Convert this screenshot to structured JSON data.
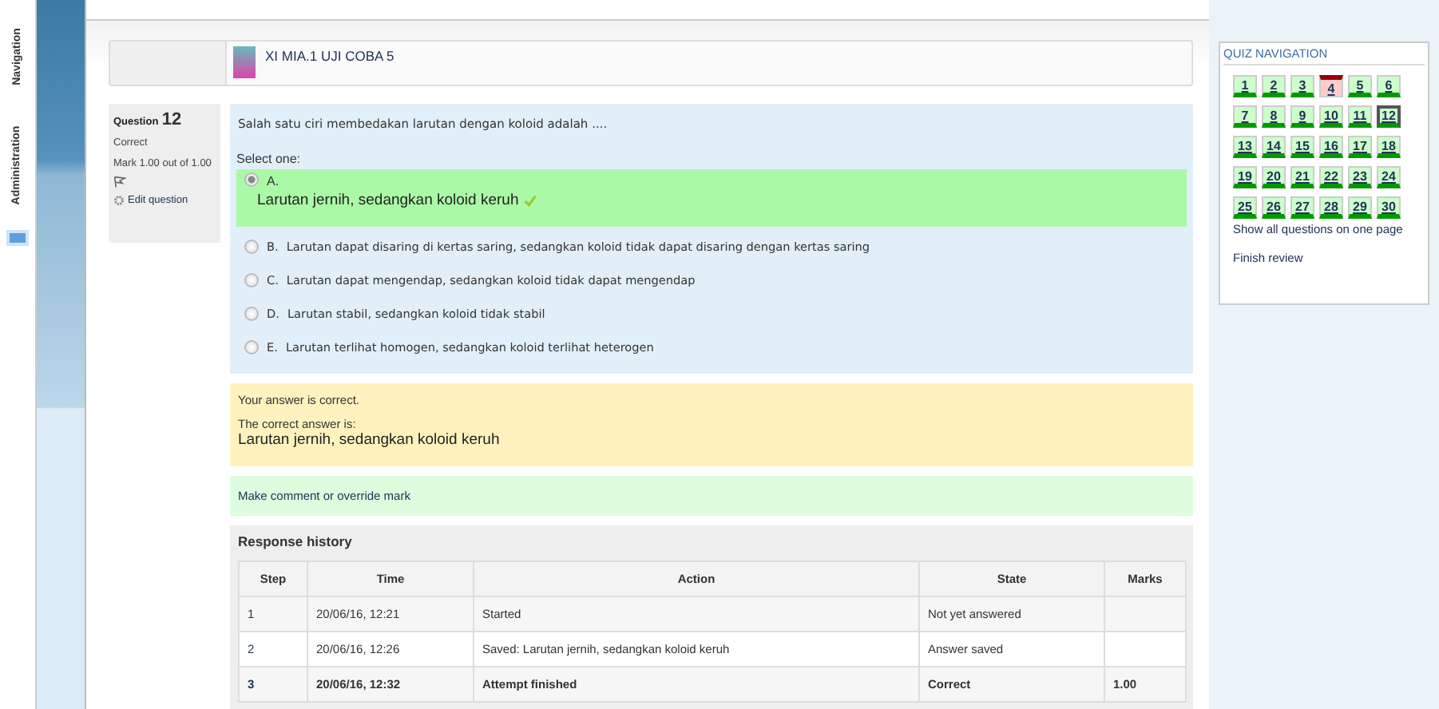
{
  "side_tabs": [
    "Navigation",
    "Administration"
  ],
  "header": {
    "title": "XI MIA.1 UJI COBA 5"
  },
  "info": {
    "label": "Question",
    "number": "12",
    "status": "Correct",
    "mark": "Mark 1.00 out of 1.00",
    "edit": "Edit question"
  },
  "question": {
    "text": "Salah satu ciri membedakan larutan dengan koloid adalah ....",
    "prompt": "Select one:",
    "options": [
      {
        "letter": "A.",
        "text": "Larutan jernih, sedangkan koloid keruh",
        "selected": true,
        "correct": true
      },
      {
        "letter": "B.",
        "text": "Larutan dapat disaring di kertas saring, sedangkan koloid tidak dapat disaring dengan kertas saring",
        "selected": false,
        "correct": false
      },
      {
        "letter": "C.",
        "text": "Larutan dapat mengendap, sedangkan koloid tidak dapat mengendap",
        "selected": false,
        "correct": false
      },
      {
        "letter": "D.",
        "text": "Larutan stabil, sedangkan koloid tidak stabil",
        "selected": false,
        "correct": false
      },
      {
        "letter": "E.",
        "text": "Larutan terlihat homogen, sedangkan koloid terlihat heterogen",
        "selected": false,
        "correct": false
      }
    ]
  },
  "feedback": {
    "result": "Your answer is correct.",
    "correct_label": "The correct answer is:",
    "correct_answer": "Larutan jernih, sedangkan koloid keruh"
  },
  "comment_link": "Make comment or override mark",
  "history": {
    "title": "Response history",
    "columns": [
      "Step",
      "Time",
      "Action",
      "State",
      "Marks"
    ],
    "rows": [
      {
        "bold": false,
        "cells": [
          "1",
          "20/06/16, 12:21",
          "Started",
          "Not yet answered",
          ""
        ]
      },
      {
        "bold": false,
        "cells": [
          "2",
          "20/06/16, 12:26",
          "Saved: Larutan jernih, sedangkan koloid keruh",
          "Answer saved",
          ""
        ]
      },
      {
        "bold": true,
        "cells": [
          "3",
          "20/06/16, 12:32",
          "Attempt finished",
          "Correct",
          "1.00"
        ]
      }
    ]
  },
  "quiz_nav": {
    "title": "QUIZ NAVIGATION",
    "buttons": [
      {
        "label": "1",
        "correct": true,
        "selected": false
      },
      {
        "label": "2",
        "correct": true,
        "selected": false
      },
      {
        "label": "3",
        "correct": true,
        "selected": false
      },
      {
        "label": "4",
        "correct": false,
        "selected": false
      },
      {
        "label": "5",
        "correct": true,
        "selected": false
      },
      {
        "label": "6",
        "correct": true,
        "selected": false
      },
      {
        "label": "7",
        "correct": true,
        "selected": false
      },
      {
        "label": "8",
        "correct": true,
        "selected": false
      },
      {
        "label": "9",
        "correct": true,
        "selected": false
      },
      {
        "label": "10",
        "correct": true,
        "selected": false
      },
      {
        "label": "11",
        "correct": true,
        "selected": false
      },
      {
        "label": "12",
        "correct": true,
        "selected": true
      },
      {
        "label": "13",
        "correct": true,
        "selected": false
      },
      {
        "label": "14",
        "correct": true,
        "selected": false
      },
      {
        "label": "15",
        "correct": true,
        "selected": false
      },
      {
        "label": "16",
        "correct": true,
        "selected": false
      },
      {
        "label": "17",
        "correct": true,
        "selected": false
      },
      {
        "label": "18",
        "correct": true,
        "selected": false
      },
      {
        "label": "19",
        "correct": true,
        "selected": false
      },
      {
        "label": "20",
        "correct": true,
        "selected": false
      },
      {
        "label": "21",
        "correct": true,
        "selected": false
      },
      {
        "label": "22",
        "correct": true,
        "selected": false
      },
      {
        "label": "23",
        "correct": true,
        "selected": false
      },
      {
        "label": "24",
        "correct": true,
        "selected": false
      },
      {
        "label": "25",
        "correct": true,
        "selected": false
      },
      {
        "label": "26",
        "correct": true,
        "selected": false
      },
      {
        "label": "27",
        "correct": true,
        "selected": false
      },
      {
        "label": "28",
        "correct": true,
        "selected": false
      },
      {
        "label": "29",
        "correct": true,
        "selected": false
      },
      {
        "label": "30",
        "correct": true,
        "selected": false
      }
    ],
    "links": [
      "Show all questions on one page",
      "Finish review"
    ]
  }
}
